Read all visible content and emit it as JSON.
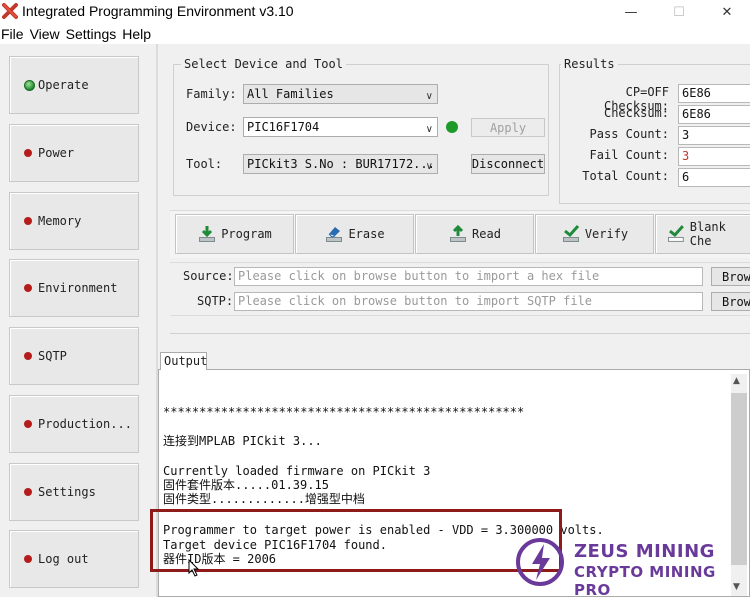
{
  "window": {
    "title": "Integrated Programming Environment v3.10",
    "minimize_glyph": "—",
    "maximize_glyph": "☐",
    "close_glyph": "✕",
    "icon": "app-x-icon"
  },
  "menu": [
    "File",
    "View",
    "Settings",
    "Help"
  ],
  "sidebar": [
    {
      "label": "Operate",
      "status": "green"
    },
    {
      "label": "Power",
      "status": "red"
    },
    {
      "label": "Memory",
      "status": "red"
    },
    {
      "label": "Environment",
      "status": "red"
    },
    {
      "label": "SQTP",
      "status": "red"
    },
    {
      "label": "Production...",
      "status": "red"
    },
    {
      "label": "Settings",
      "status": "red"
    },
    {
      "label": "Log out",
      "status": "red"
    }
  ],
  "device_tool": {
    "group_title": "Select Device and Tool",
    "family_label": "Family:",
    "family_value": "All Families",
    "device_label": "Device:",
    "device_value": "PIC16F1704",
    "apply_label": "Apply",
    "tool_label": "Tool:",
    "tool_value": "PICkit3 S.No : BUR17172...",
    "disconnect_label": "Disconnect",
    "status_color": "#1e9a2a"
  },
  "results": {
    "group_title": "Results",
    "rows": [
      {
        "label": "CP=OFF Checksum:",
        "value": "6E86",
        "style": "normal"
      },
      {
        "label": "Checksum:",
        "value": "6E86",
        "style": "normal"
      },
      {
        "label": "Pass Count:",
        "value": "3",
        "style": "normal"
      },
      {
        "label": "Fail Count:",
        "value": "3",
        "style": "red"
      },
      {
        "label": "Total Count:",
        "value": "6",
        "style": "normal"
      }
    ]
  },
  "actions": [
    {
      "label": "Program",
      "icon": "program-download-icon"
    },
    {
      "label": "Erase",
      "icon": "erase-icon"
    },
    {
      "label": "Read",
      "icon": "read-upload-icon"
    },
    {
      "label": "Verify",
      "icon": "verify-check-icon"
    },
    {
      "label": "Blank Che",
      "icon": "blank-check-icon"
    }
  ],
  "source": {
    "label": "Source:",
    "placeholder": "Please click on browse button to import a hex file",
    "browse_label": "Brow"
  },
  "sqtp": {
    "label": "SQTP:",
    "placeholder": "Please click on browse button to import SQTP file",
    "browse_label": "Brow"
  },
  "output": {
    "tab_label": "Output",
    "lines": [
      "**************************************************",
      "",
      "连接到MPLAB PICkit 3...",
      "",
      "Currently loaded firmware on PICkit 3",
      "固件套件版本.....01.39.15",
      "固件类型.............增强型中档",
      "",
      "Programmer to target power is enabled - VDD = 3.300000 volts.",
      "Target device PIC16F1704 found.",
      "器件ID版本 = 2006"
    ]
  },
  "watermark": {
    "line1": "ZEUS MINING",
    "line2": "CRYPTO MINING PRO",
    "color": "#6a3a9a"
  }
}
